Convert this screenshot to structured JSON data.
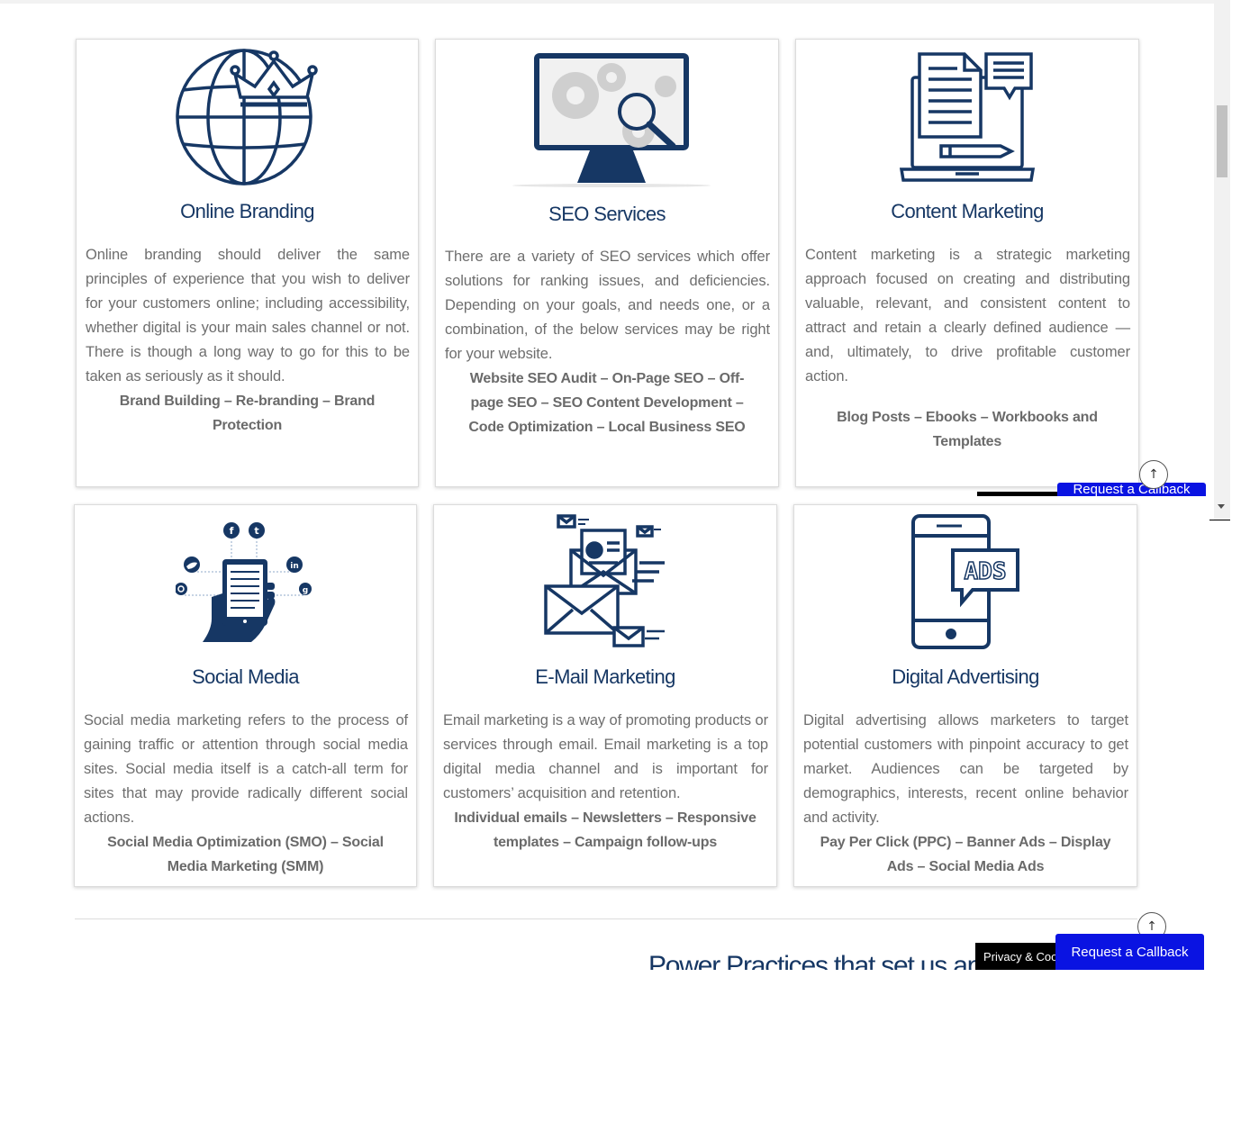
{
  "cards": [
    {
      "title": "Online Branding",
      "icon": "globe-crown-icon",
      "description": "Online branding should deliver the same principles of experience that you wish to deliver for your customers online; including accessibility, whether digital is your main sales channel or not. There is though a long way to go for this to be taken as seriously as it should.",
      "tags": "Brand Building – Re-branding – Brand Protection"
    },
    {
      "title": "SEO Services",
      "icon": "monitor-magnifier-icon",
      "description": "There are a variety of SEO services which offer solutions for ranking issues, and deficiencies. Depending on your goals, and needs one, or a combination, of the below services may be right for your website.",
      "tags": "Website SEO Audit – On-Page SEO – Off-page SEO – SEO Content Development – Code Optimization – Local Business SEO"
    },
    {
      "title": "Content Marketing",
      "icon": "laptop-documents-icon",
      "description": "Content marketing is a strategic marketing approach focused on creating and distributing valuable, relevant, and consistent content to attract and retain a clearly defined audience — and, ultimately, to drive profitable customer action.",
      "tags": "Blog Posts – Ebooks – Workbooks and Templates"
    },
    {
      "title": "Social Media",
      "icon": "hand-phone-social-icon",
      "description": "Social media marketing refers to the process of gaining traffic or attention through social media sites. Social media itself is a catch-all term for sites that may provide radically different social actions.",
      "tags": "Social Media Optimization (SMO) – Social Media Marketing (SMM)"
    },
    {
      "title": "E-Mail Marketing",
      "icon": "envelopes-icon",
      "description": "Email marketing is a way of promoting products or services through email. Email marketing is a top digital media channel and is important for customers’ acquisition and retention.",
      "tags": "Individual emails – Newsletters – Responsive templates – Campaign follow-ups"
    },
    {
      "title": "Digital Advertising",
      "icon": "phone-ads-icon",
      "description": "Digital advertising allows marketers to target potential customers with pinpoint accuracy to get market. Audiences can be targeted by demographics, interests, recent online behavior and activity.",
      "tags": "Pay Per Click (PPC) – Banner Ads – Display Ads – Social Media Ads"
    }
  ],
  "social_icons": [
    "f",
    "t",
    "in",
    "g"
  ],
  "ads_label": "ADS",
  "section_title": "Power Practices that set us apart",
  "floating": {
    "callback_label": "Request a Callback",
    "privacy_label": "Privacy & Cookies Policy",
    "scroll_top_symbol": "↑"
  },
  "colors": {
    "heading": "#163764",
    "icon": "#163764",
    "body_text": "#6e6e6e",
    "callback_bg": "#0a13e2",
    "privacy_bg": "#000000"
  }
}
